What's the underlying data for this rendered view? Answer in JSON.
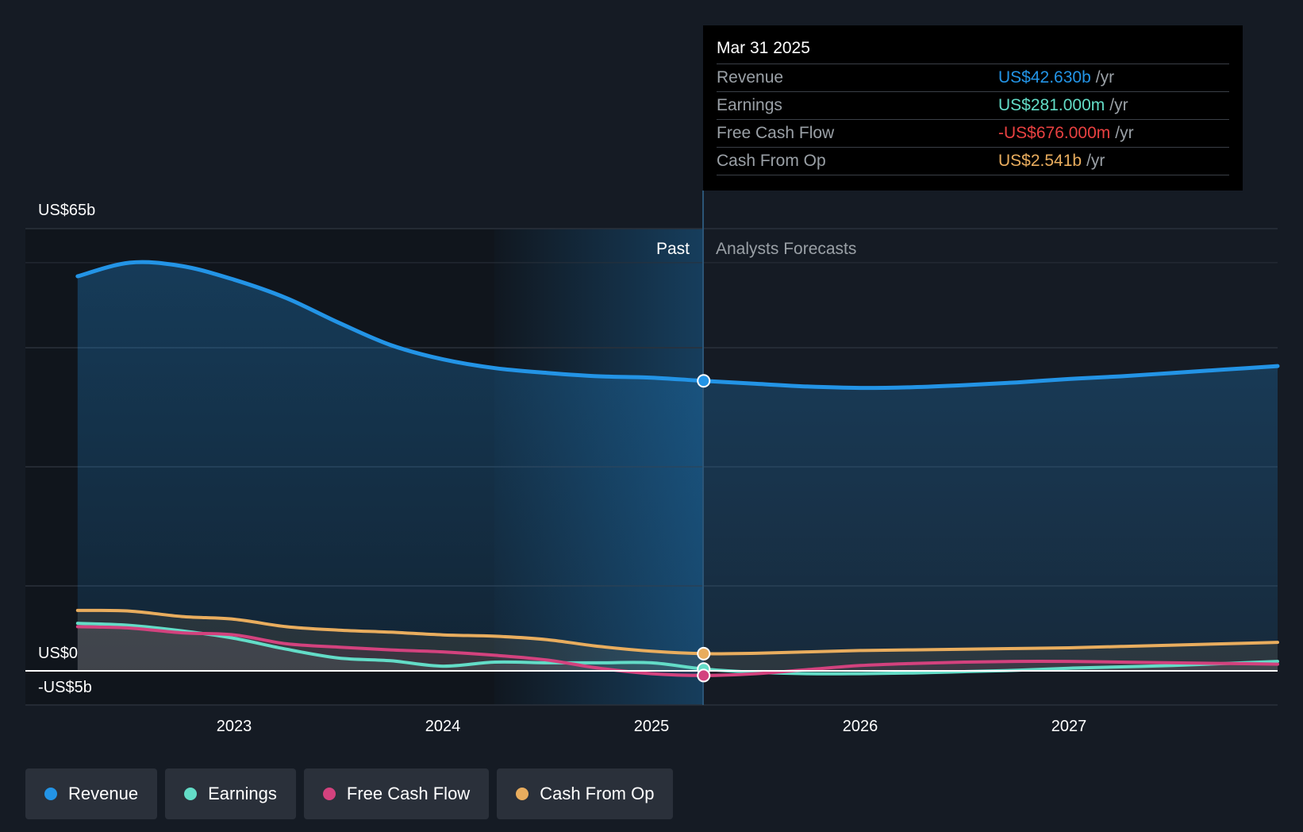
{
  "colors": {
    "background": "#151b24",
    "revenue": "#2394e6",
    "earnings": "#63dcc7",
    "free_cash_flow": "#d3427e",
    "cash_from_op": "#e9ad5e",
    "negative": "#e84141"
  },
  "tooltip": {
    "date": "Mar 31 2025",
    "rows": [
      {
        "label": "Revenue",
        "value": "US$42.630b",
        "unit": "/yr"
      },
      {
        "label": "Earnings",
        "value": "US$281.000m",
        "unit": "/yr"
      },
      {
        "label": "Free Cash Flow",
        "value": "-US$676.000m",
        "unit": "/yr"
      },
      {
        "label": "Cash From Op",
        "value": "US$2.541b",
        "unit": "/yr"
      }
    ]
  },
  "chart_data": {
    "type": "line",
    "y_axis_labels": [
      "US$65b",
      "US$0",
      "-US$5b"
    ],
    "ylim": [
      -5,
      65
    ],
    "x_ticks": [
      "2023",
      "2024",
      "2025",
      "2026",
      "2027"
    ],
    "x_tick_values": [
      2023,
      2024,
      2025,
      2026,
      2027
    ],
    "xlim": [
      2022.0,
      2028.0
    ],
    "grid": true,
    "divider_x": 2025.25,
    "past_label": "Past",
    "forecast_label": "Analysts Forecasts",
    "series": [
      {
        "name": "Revenue",
        "x": [
          2022.25,
          2022.5,
          2022.75,
          2023.0,
          2023.25,
          2023.5,
          2023.75,
          2024.0,
          2024.25,
          2024.5,
          2024.75,
          2025.0,
          2025.25,
          2025.5,
          2025.75,
          2026.0,
          2026.25,
          2026.5,
          2026.75,
          2027.0,
          2027.25,
          2027.5,
          2027.75,
          2028.0
        ],
        "y": [
          58.0,
          60.0,
          59.5,
          57.5,
          54.8,
          51.2,
          47.9,
          45.8,
          44.5,
          43.8,
          43.3,
          43.1,
          42.63,
          42.2,
          41.8,
          41.6,
          41.7,
          42.0,
          42.4,
          42.9,
          43.3,
          43.8,
          44.3,
          44.8
        ]
      },
      {
        "name": "Earnings",
        "x": [
          2022.25,
          2022.5,
          2022.75,
          2023.0,
          2023.25,
          2023.5,
          2023.75,
          2024.0,
          2024.25,
          2024.5,
          2024.75,
          2025.0,
          2025.25,
          2025.5,
          2025.75,
          2026.0,
          2026.25,
          2026.5,
          2026.75,
          2027.0,
          2027.25,
          2027.5,
          2027.75,
          2028.0
        ],
        "y": [
          7.0,
          6.7,
          5.9,
          4.8,
          3.2,
          1.9,
          1.5,
          0.7,
          1.3,
          1.2,
          1.2,
          1.2,
          0.281,
          -0.2,
          -0.4,
          -0.4,
          -0.3,
          -0.1,
          0.1,
          0.4,
          0.6,
          0.8,
          1.1,
          1.4
        ]
      },
      {
        "name": "Free Cash Flow",
        "x": [
          2022.25,
          2022.5,
          2022.75,
          2023.0,
          2023.25,
          2023.5,
          2023.75,
          2024.0,
          2024.25,
          2024.5,
          2024.75,
          2025.0,
          2025.25,
          2025.5,
          2025.75,
          2026.0,
          2026.25,
          2026.5,
          2026.75,
          2027.0,
          2027.25,
          2027.5,
          2027.75,
          2028.0
        ],
        "y": [
          6.5,
          6.3,
          5.6,
          5.3,
          4.0,
          3.5,
          3.1,
          2.8,
          2.3,
          1.6,
          0.4,
          -0.4,
          -0.676,
          -0.4,
          0.2,
          0.8,
          1.1,
          1.3,
          1.4,
          1.4,
          1.3,
          1.2,
          1.1,
          1.0
        ]
      },
      {
        "name": "Cash From Op",
        "x": [
          2022.25,
          2022.5,
          2022.75,
          2023.0,
          2023.25,
          2023.5,
          2023.75,
          2024.0,
          2024.25,
          2024.5,
          2024.75,
          2025.0,
          2025.25,
          2025.5,
          2025.75,
          2026.0,
          2026.25,
          2026.5,
          2026.75,
          2027.0,
          2027.25,
          2027.5,
          2027.75,
          2028.0
        ],
        "y": [
          8.9,
          8.8,
          8.0,
          7.6,
          6.5,
          6.0,
          5.7,
          5.3,
          5.1,
          4.6,
          3.6,
          2.9,
          2.541,
          2.6,
          2.8,
          3.0,
          3.1,
          3.2,
          3.3,
          3.4,
          3.6,
          3.8,
          4.0,
          4.2
        ]
      }
    ]
  },
  "legend": {
    "items": [
      {
        "label": "Revenue"
      },
      {
        "label": "Earnings"
      },
      {
        "label": "Free Cash Flow"
      },
      {
        "label": "Cash From Op"
      }
    ]
  }
}
